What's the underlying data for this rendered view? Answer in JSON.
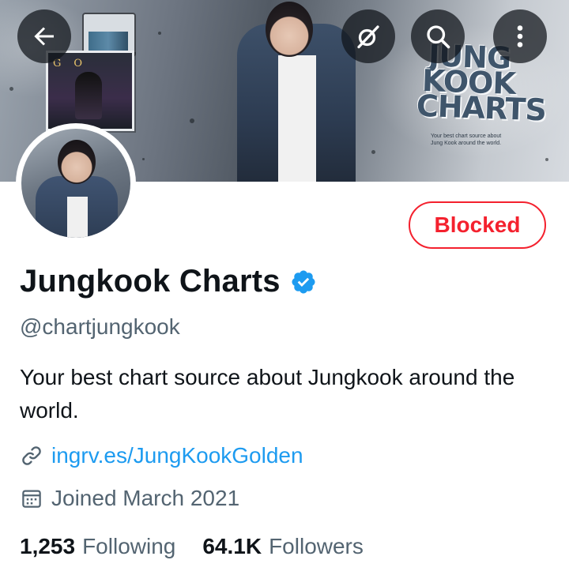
{
  "profile": {
    "display_name": "Jungkook Charts",
    "handle": "@chartjungkook",
    "bio": "Your best chart source about Jungkook around the world.",
    "website": "ingrv.es/JungKookGolden",
    "joined": "Joined March 2021",
    "verified": true,
    "relationship_button": "Blocked"
  },
  "stats": {
    "following_count": "1,253",
    "following_label": "Following",
    "followers_count": "64.1K",
    "followers_label": "Followers"
  },
  "banner": {
    "title": "JUNG KOOK CHARTS",
    "subtitle": "Your best chart source about Jung Kook around the world.",
    "poster_text": "GO"
  },
  "icons": {
    "back": "back-arrow-icon",
    "grok": "grok-icon",
    "search": "search-icon",
    "more": "more-vertical-icon",
    "verified": "verified-badge-icon",
    "link": "link-icon",
    "calendar": "calendar-icon"
  },
  "colors": {
    "blocked_red": "#f4212e",
    "link_blue": "#1d9bf0",
    "verified_blue": "#1d9bf0",
    "secondary_text": "#536471",
    "primary_text": "#0f1419"
  }
}
